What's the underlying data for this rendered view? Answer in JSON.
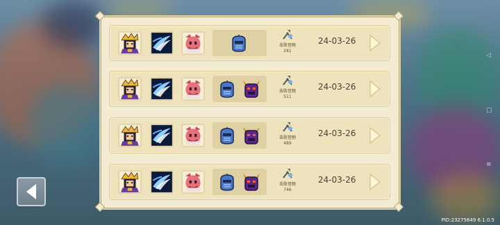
{
  "records": [
    {
      "kills_label": "击败怪物",
      "kills": "281",
      "date": "24-03-26",
      "enemies": [
        "knight-enemy-icon"
      ]
    },
    {
      "kills_label": "击败怪物",
      "kills": "511",
      "date": "24-03-26",
      "enemies": [
        "knight-enemy-icon",
        "demon-enemy-icon"
      ]
    },
    {
      "kills_label": "击败怪物",
      "kills": "489",
      "date": "24-03-26",
      "enemies": [
        "knight-enemy-icon",
        "demon-enemy-icon"
      ]
    },
    {
      "kills_label": "击败怪物",
      "kills": "746",
      "date": "24-03-26",
      "enemies": [
        "knight-enemy-icon",
        "demon-enemy-icon"
      ]
    }
  ],
  "footer": {
    "pid": "PID:23275649 6.1.0.5"
  },
  "colors": {
    "panel": "#f4ecd2",
    "row": "#efe3bd",
    "arrow": "#fff7d8"
  }
}
